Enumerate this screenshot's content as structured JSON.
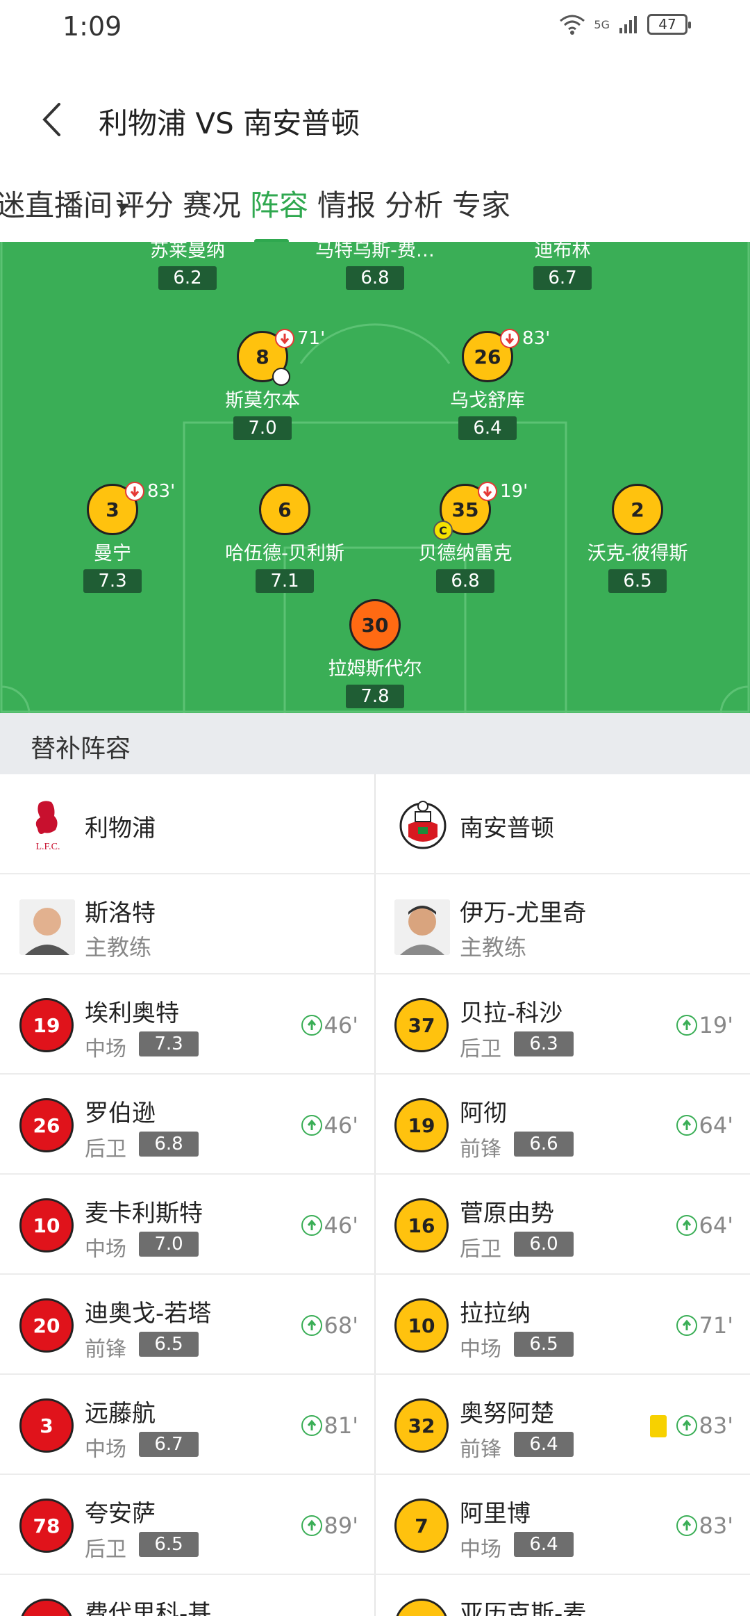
{
  "status": {
    "time": "1:09",
    "network": "5G",
    "battery": "47"
  },
  "header": {
    "title": "利物浦 VS 南安普顿"
  },
  "tabs": [
    {
      "label": "迷直播间"
    },
    {
      "label": "评分"
    },
    {
      "label": "赛况"
    },
    {
      "label": "阵容",
      "active": true
    },
    {
      "label": "情报"
    },
    {
      "label": "分析"
    },
    {
      "label": "专家"
    }
  ],
  "pitch": {
    "top_row": [
      {
        "name": "苏莱曼纳",
        "rating": "6.2"
      },
      {
        "name": "马特乌斯-费…",
        "rating": "6.8"
      },
      {
        "name": "迪布林",
        "rating": "6.7"
      }
    ],
    "mid_row": [
      {
        "number": "8",
        "name": "斯莫尔本",
        "rating": "7.0",
        "sub_out": "71'"
      },
      {
        "number": "26",
        "name": "乌戈舒库",
        "rating": "6.4",
        "sub_out": "83'"
      }
    ],
    "def_row": [
      {
        "number": "3",
        "name": "曼宁",
        "rating": "7.3",
        "sub_out": "83'"
      },
      {
        "number": "6",
        "name": "哈伍德-贝利斯",
        "rating": "7.1"
      },
      {
        "number": "35",
        "name": "贝德纳雷克",
        "rating": "6.8",
        "sub_out": "19'",
        "captain": "C"
      },
      {
        "number": "2",
        "name": "沃克-彼得斯",
        "rating": "6.5"
      }
    ],
    "keeper": {
      "number": "30",
      "name": "拉姆斯代尔",
      "rating": "7.8"
    }
  },
  "subs": {
    "title": "替补阵容",
    "home": {
      "team": "利物浦",
      "logo_text": "L.F.C.",
      "coach": {
        "name": "斯洛特",
        "role": "主教练"
      },
      "players": [
        {
          "number": "19",
          "name": "埃利奥特",
          "position": "中场",
          "rating": "7.3",
          "in": "46'"
        },
        {
          "number": "26",
          "name": "罗伯逊",
          "position": "后卫",
          "rating": "6.8",
          "in": "46'"
        },
        {
          "number": "10",
          "name": "麦卡利斯特",
          "position": "中场",
          "rating": "7.0",
          "in": "46'"
        },
        {
          "number": "20",
          "name": "迪奥戈-若塔",
          "position": "前锋",
          "rating": "6.5",
          "in": "68'"
        },
        {
          "number": "3",
          "name": "远藤航",
          "position": "中场",
          "rating": "6.7",
          "in": "81'"
        },
        {
          "number": "78",
          "name": "夸安萨",
          "position": "后卫",
          "rating": "6.5",
          "in": "89'"
        },
        {
          "number": "",
          "name": "费代里科-基",
          "position": "",
          "rating": "",
          "in": ""
        }
      ]
    },
    "away": {
      "team": "南安普顿",
      "coach": {
        "name": "伊万-尤里奇",
        "role": "主教练"
      },
      "players": [
        {
          "number": "37",
          "name": "贝拉-科沙",
          "position": "后卫",
          "rating": "6.3",
          "in": "19'"
        },
        {
          "number": "19",
          "name": "阿彻",
          "position": "前锋",
          "rating": "6.6",
          "in": "64'"
        },
        {
          "number": "16",
          "name": "菅原由势",
          "position": "后卫",
          "rating": "6.0",
          "in": "64'"
        },
        {
          "number": "10",
          "name": "拉拉纳",
          "position": "中场",
          "rating": "6.5",
          "in": "71'"
        },
        {
          "number": "32",
          "name": "奥努阿楚",
          "position": "前锋",
          "rating": "6.4",
          "in": "83'",
          "yellow_card": true
        },
        {
          "number": "7",
          "name": "阿里博",
          "position": "中场",
          "rating": "6.4",
          "in": "83'"
        },
        {
          "number": "",
          "name": "亚历克斯-麦",
          "position": "",
          "rating": "",
          "in": ""
        }
      ]
    }
  },
  "colors": {
    "accent": "#2fa84f",
    "pitch": "#3aae56",
    "home": "#e0131b",
    "away": "#ffc20e",
    "keeper": "#ff6a13"
  }
}
